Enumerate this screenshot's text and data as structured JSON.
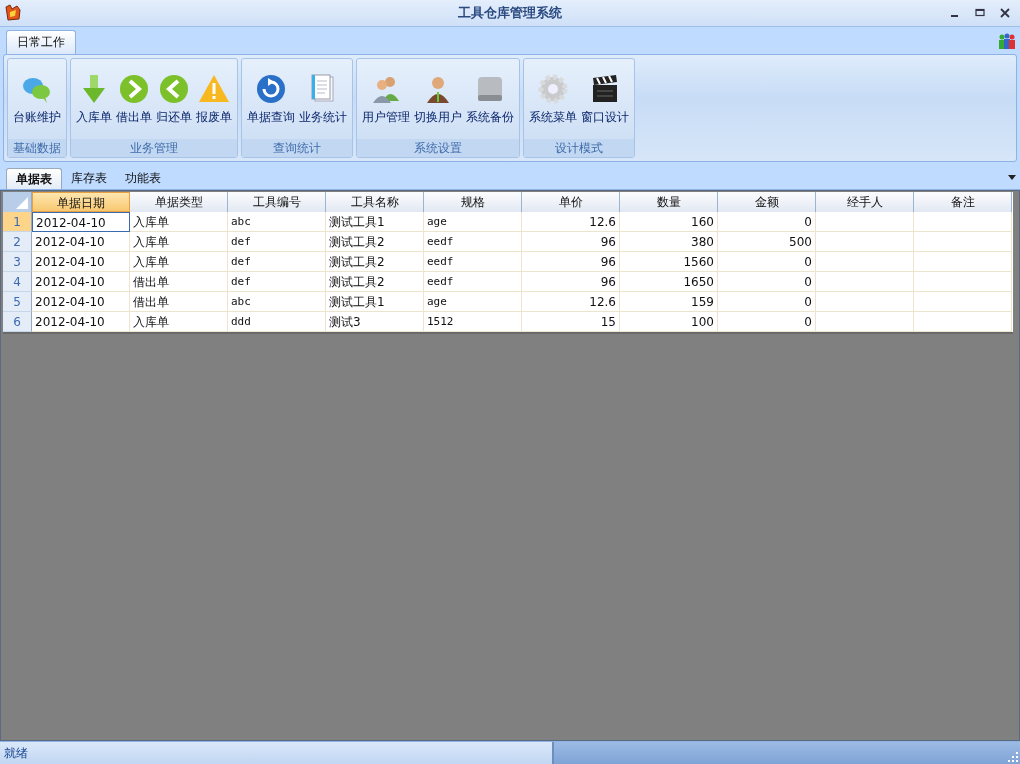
{
  "window": {
    "title": "工具仓库管理系统"
  },
  "ribbon": {
    "tabs": [
      {
        "label": "日常工作",
        "selected": true
      }
    ],
    "groups": [
      {
        "title": "基础数据",
        "buttons": [
          {
            "label": "台账维护"
          }
        ]
      },
      {
        "title": "业务管理",
        "buttons": [
          {
            "label": "入库单"
          },
          {
            "label": "借出单"
          },
          {
            "label": "归还单"
          },
          {
            "label": "报废单"
          }
        ]
      },
      {
        "title": "查询统计",
        "buttons": [
          {
            "label": "单据查询"
          },
          {
            "label": "业务统计"
          }
        ]
      },
      {
        "title": "系统设置",
        "buttons": [
          {
            "label": "用户管理"
          },
          {
            "label": "切换用户"
          },
          {
            "label": "系统备份"
          }
        ]
      },
      {
        "title": "设计模式",
        "buttons": [
          {
            "label": "系统菜单"
          },
          {
            "label": "窗口设计"
          }
        ]
      }
    ]
  },
  "doc_tabs": [
    {
      "label": "单据表",
      "selected": true
    },
    {
      "label": "库存表",
      "selected": false
    },
    {
      "label": "功能表",
      "selected": false
    }
  ],
  "table": {
    "columns": [
      {
        "label": "单据日期",
        "kind": "text",
        "selected": true
      },
      {
        "label": "单据类型",
        "kind": "text",
        "selected": false
      },
      {
        "label": "工具编号",
        "kind": "mono",
        "selected": false
      },
      {
        "label": "工具名称",
        "kind": "text",
        "selected": false
      },
      {
        "label": "规格",
        "kind": "mono",
        "selected": false
      },
      {
        "label": "单价",
        "kind": "number",
        "selected": false
      },
      {
        "label": "数量",
        "kind": "number",
        "selected": false
      },
      {
        "label": "金额",
        "kind": "number",
        "selected": false
      },
      {
        "label": "经手人",
        "kind": "text",
        "selected": false
      },
      {
        "label": "备注",
        "kind": "text",
        "selected": false
      }
    ],
    "rows": [
      {
        "number": "1",
        "selected": true,
        "cells": [
          "2012-04-10",
          "入库单",
          "abc",
          "测试工具1",
          "age",
          "12.6",
          "160",
          "0",
          "",
          ""
        ]
      },
      {
        "number": "2",
        "selected": false,
        "cells": [
          "2012-04-10",
          "入库单",
          "def",
          "测试工具2",
          "eedf",
          "96",
          "380",
          "500",
          "",
          ""
        ]
      },
      {
        "number": "3",
        "selected": false,
        "cells": [
          "2012-04-10",
          "入库单",
          "def",
          "测试工具2",
          "eedf",
          "96",
          "1560",
          "0",
          "",
          ""
        ]
      },
      {
        "number": "4",
        "selected": false,
        "cells": [
          "2012-04-10",
          "借出单",
          "def",
          "测试工具2",
          "eedf",
          "96",
          "1650",
          "0",
          "",
          ""
        ]
      },
      {
        "number": "5",
        "selected": false,
        "cells": [
          "2012-04-10",
          "借出单",
          "abc",
          "测试工具1",
          "age",
          "12.6",
          "159",
          "0",
          "",
          ""
        ]
      },
      {
        "number": "6",
        "selected": false,
        "cells": [
          "2012-04-10",
          "入库单",
          "ddd",
          "测试3",
          "1512",
          "15",
          "100",
          "0",
          "",
          ""
        ]
      }
    ]
  },
  "status_bar": {
    "text": "就绪"
  }
}
